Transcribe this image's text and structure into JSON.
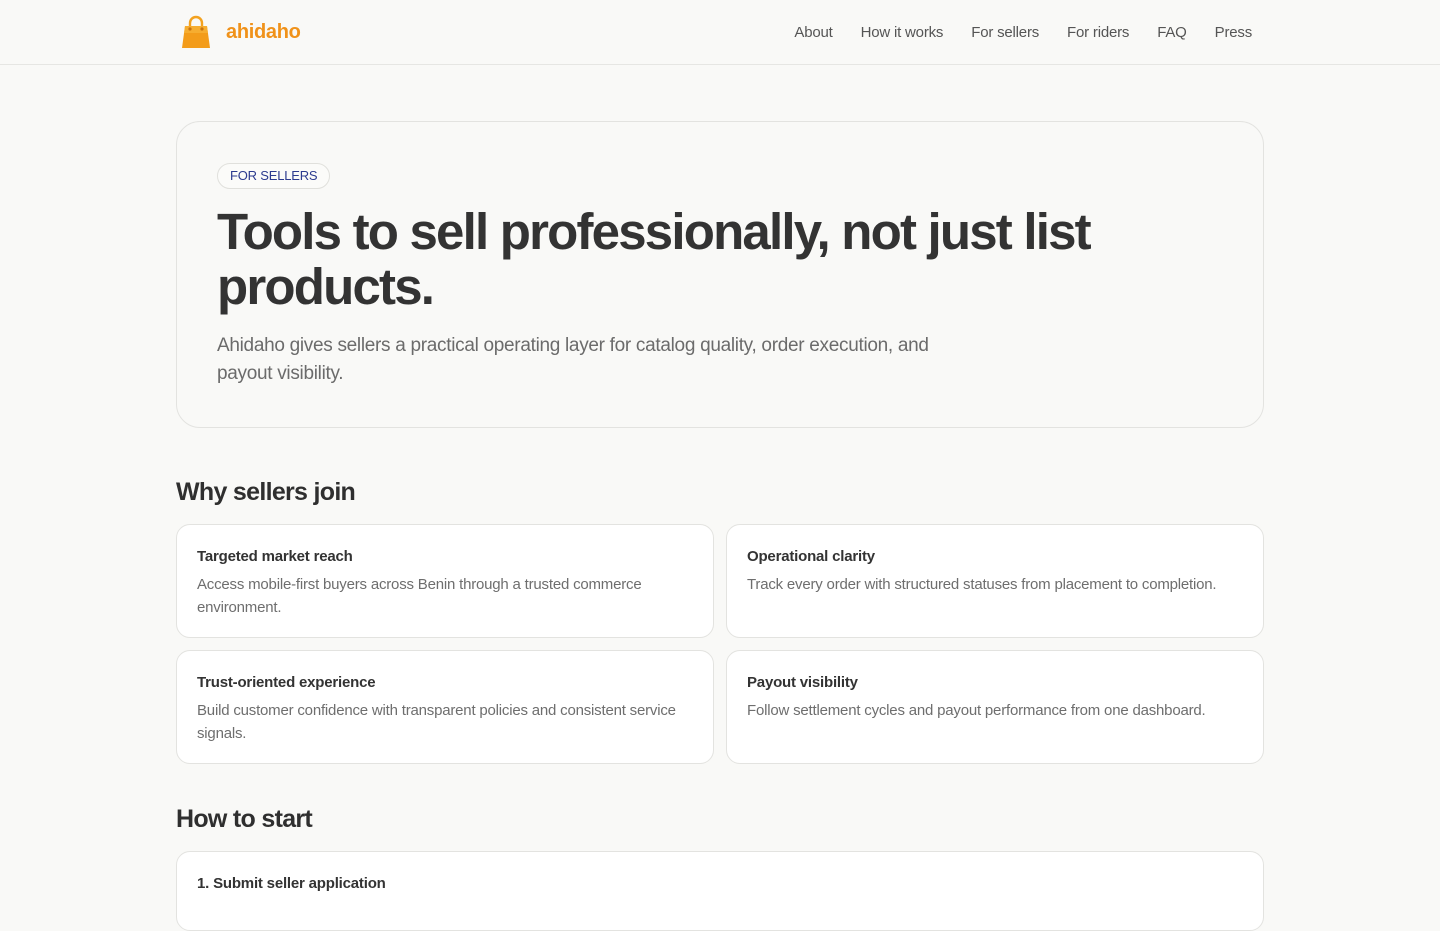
{
  "header": {
    "brand_name": "ahidaho",
    "logo_icon": "shopping-bag-icon",
    "brand_color": "#f0921a",
    "nav": [
      {
        "label": "About"
      },
      {
        "label": "How it works"
      },
      {
        "label": "For sellers"
      },
      {
        "label": "For riders"
      },
      {
        "label": "FAQ"
      },
      {
        "label": "Press"
      }
    ]
  },
  "hero": {
    "tag": "FOR SELLERS",
    "title": "Tools to sell professionally, not just list products.",
    "subtitle": "Ahidaho gives sellers a practical operating layer for catalog quality, order execution, and payout visibility."
  },
  "why": {
    "heading": "Why sellers join",
    "cards": [
      {
        "title": "Targeted market reach",
        "text": "Access mobile-first buyers across Benin through a trusted commerce environment."
      },
      {
        "title": "Operational clarity",
        "text": "Track every order with structured statuses from placement to completion."
      },
      {
        "title": "Trust-oriented experience",
        "text": "Build customer confidence with transparent policies and consistent service signals."
      },
      {
        "title": "Payout visibility",
        "text": "Follow settlement cycles and payout performance from one dashboard."
      }
    ]
  },
  "start": {
    "heading": "How to start",
    "steps": [
      {
        "title": "1. Submit seller application"
      }
    ]
  }
}
